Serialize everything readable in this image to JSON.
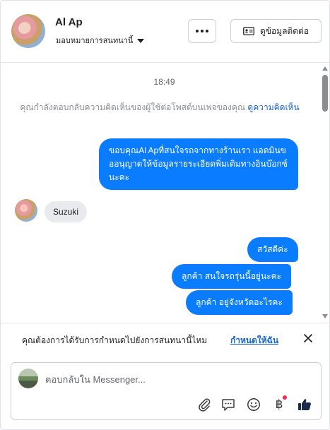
{
  "header": {
    "contact_name": "Al Ap",
    "assign_label": "มอบหมายการสนทนานี้",
    "contact_info_label": "ดูข้อมูลติดต่อ"
  },
  "chat": {
    "time": "18:49",
    "notice_text": "คุณกำลังตอบกลับความคิดเห็นของผู้ใช้ต่อโพสต์บนเพจของคุณ ",
    "notice_link": "ดูความคิดเห็น",
    "messages_out_first": "ขอบคุณAl Apที่สนใจรถจากทางร้านเรา แอดมินขออนุญาตให้ข้อมูลรายระเอียดพิ่มเติมทางอินบ๊อกซ์นะคะ",
    "message_in": "Suzuki",
    "messages_out": [
      "สวัสดีค่ะ",
      "ลูกค้า  สนใจรถรุ่นนี้อยู่นะคะ",
      "ลูกค้า อยู่จังหวัดอะไรคะ"
    ]
  },
  "prompt": {
    "text": "คุณต้องการได้รับการกำหนดไปยังการสนทนานี้ไหม",
    "link": "กำหนดให้ฉัน"
  },
  "composer": {
    "placeholder": "ตอบกลับใน Messenger...",
    "currency_symbol": "฿"
  },
  "colors": {
    "accent_blue": "#0a7cff",
    "link_blue": "#1763cf",
    "incoming_bubble": "#e9eaed",
    "notification_dot": "#f02849"
  },
  "icons": [
    "more-icon",
    "id-card-icon",
    "caret-down-icon",
    "close-icon",
    "paperclip-icon",
    "saved-reply-icon",
    "emoji-icon",
    "baht-icon",
    "thumbs-up-icon"
  ]
}
